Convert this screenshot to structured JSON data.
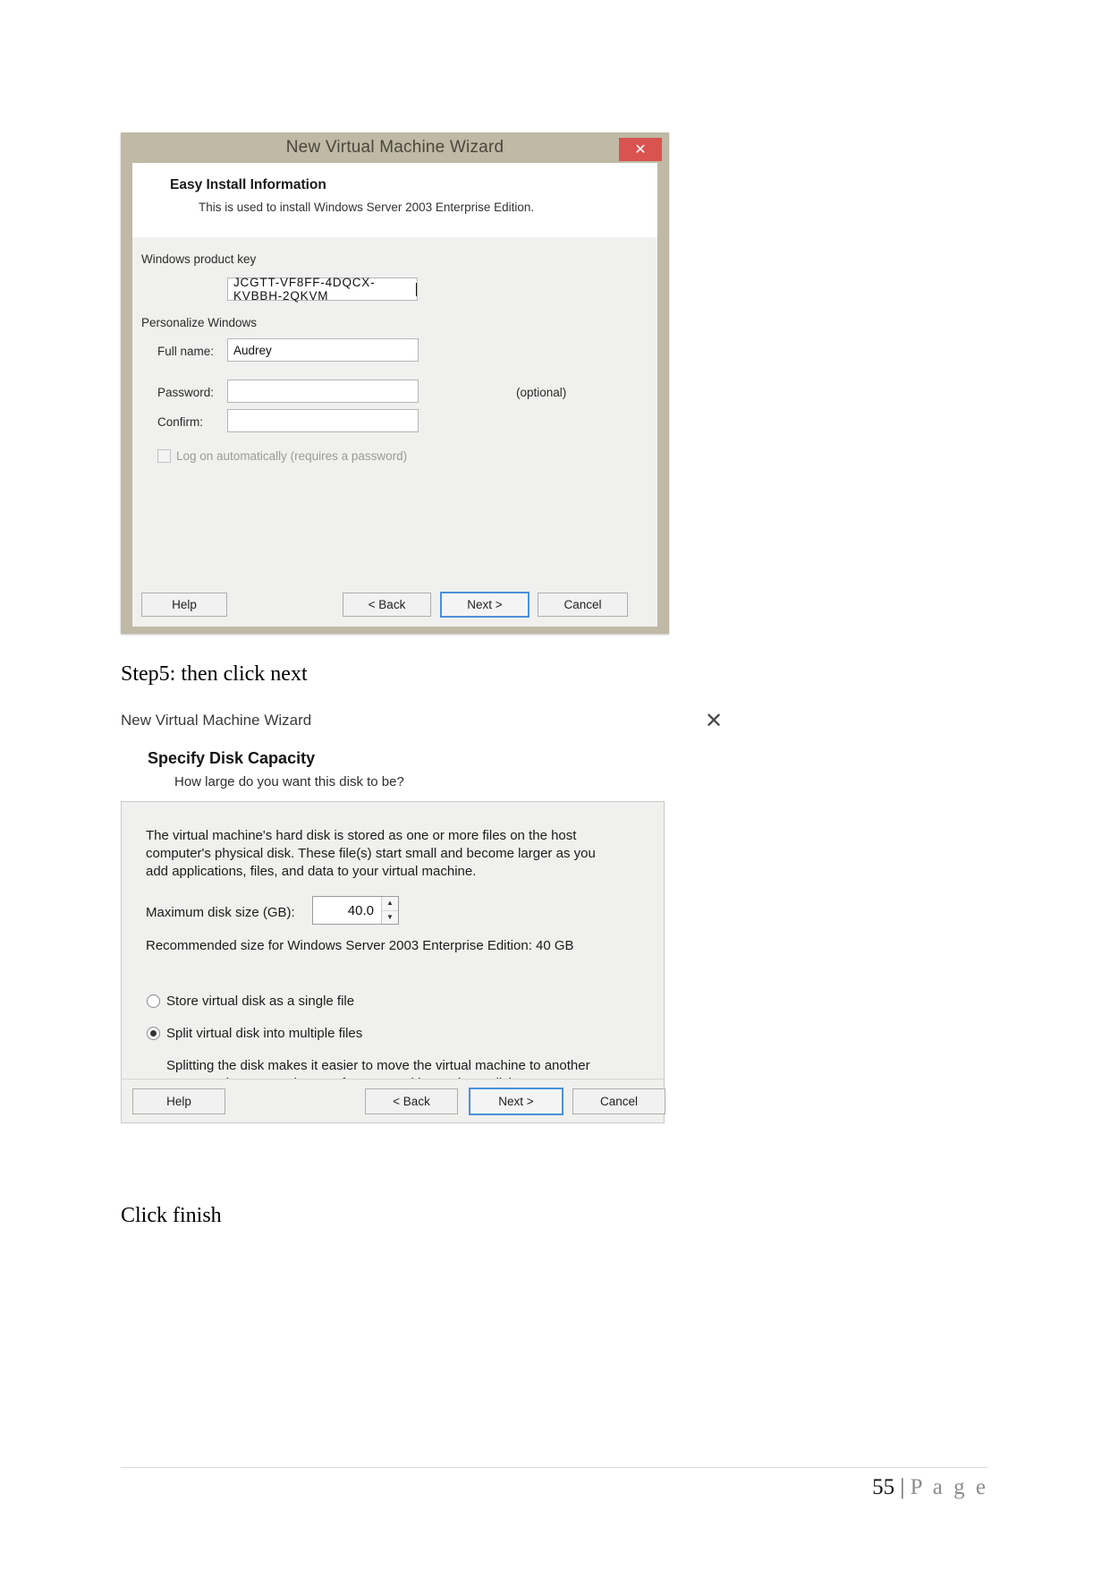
{
  "document": {
    "captions": {
      "step5": "Step5: then click next",
      "click_finish": "Click finish"
    },
    "footer": {
      "page_number": "55",
      "separator": "|",
      "page_word": "P a g e"
    }
  },
  "dialog1": {
    "window_title": "New Virtual Machine Wizard",
    "close_icon": "close-icon",
    "close_glyph": "✕",
    "header": {
      "title": "Easy Install Information",
      "subtitle": "This is used to install Windows Server 2003 Enterprise Edition."
    },
    "fields": {
      "product_key_label": "Windows product key",
      "product_key_value": "JCGTT-VF8FF-4DQCX-KVBBH-2QKVM",
      "personalize_label": "Personalize Windows",
      "full_name_label": "Full name:",
      "full_name_value": "Audrey",
      "password_label": "Password:",
      "password_value": "",
      "password_optional": "(optional)",
      "confirm_label": "Confirm:",
      "confirm_value": ""
    },
    "checkbox": {
      "label": "Log on automatically (requires a password)",
      "checked": false,
      "enabled": false
    },
    "buttons": {
      "help": "Help",
      "back": "< Back",
      "next": "Next >",
      "cancel": "Cancel",
      "focused": "Next >"
    }
  },
  "dialog2": {
    "window_title": "New Virtual Machine Wizard",
    "close_icon": "close-icon",
    "close_glyph": "✕",
    "header": {
      "title": "Specify Disk Capacity",
      "subtitle": "How large do you want this disk to be?"
    },
    "body": {
      "description_line1": "The virtual machine's hard disk is stored as one or more files on the host",
      "description_line2": "computer's physical disk. These file(s) start small and become larger as you",
      "description_line3": "add applications, files, and data to your virtual machine.",
      "max_disk_label": "Maximum disk size (GB):",
      "max_disk_value": "40.0",
      "spin_up_glyph": "▲",
      "spin_down_glyph": "▼",
      "recommended": "Recommended size for Windows Server 2003 Enterprise Edition: 40 GB",
      "radio_single": "Store virtual disk as a single file",
      "radio_split": "Split virtual disk into multiple files",
      "selected_radio": "Split virtual disk into multiple files",
      "note_line1": "Splitting the disk makes it easier to move the virtual machine to another",
      "note_line2": "computer but may reduce performance with very large disks."
    },
    "buttons": {
      "help": "Help",
      "back": "< Back",
      "next": "Next >",
      "cancel": "Cancel",
      "focused": "Next >"
    }
  },
  "colors": {
    "dialog1_chrome": "#bfb9a5",
    "close_button_red": "#d9534f",
    "panel_background": "#f0f0ee",
    "focus_blue": "#4a90d9"
  }
}
